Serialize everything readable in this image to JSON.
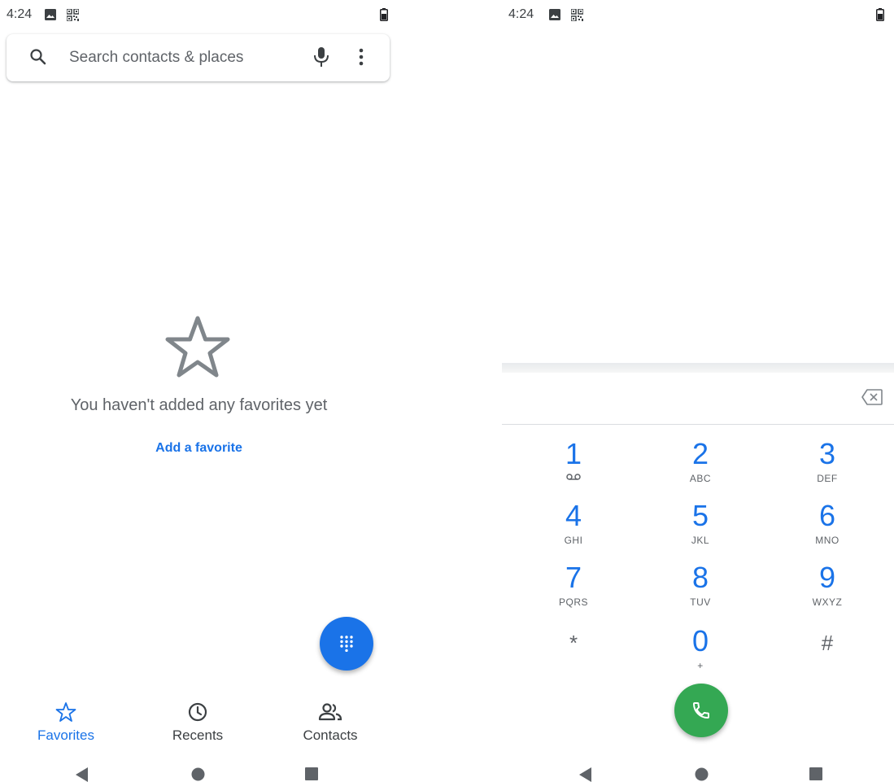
{
  "left_screen": {
    "status": {
      "time": "4:24"
    },
    "search": {
      "placeholder": "Search contacts & places"
    },
    "empty_state": {
      "message": "You haven't added any favorites yet",
      "action_label": "Add a favorite"
    },
    "bottom_nav": [
      {
        "label": "Favorites",
        "icon": "star-icon",
        "active": true
      },
      {
        "label": "Recents",
        "icon": "clock-icon",
        "active": false
      },
      {
        "label": "Contacts",
        "icon": "people-icon",
        "active": false
      }
    ]
  },
  "right_screen": {
    "status": {
      "time": "4:24"
    },
    "keypad": [
      {
        "num": "1",
        "letters": ""
      },
      {
        "num": "2",
        "letters": "ABC"
      },
      {
        "num": "3",
        "letters": "DEF"
      },
      {
        "num": "4",
        "letters": "GHI"
      },
      {
        "num": "5",
        "letters": "JKL"
      },
      {
        "num": "6",
        "letters": "MNO"
      },
      {
        "num": "7",
        "letters": "PQRS"
      },
      {
        "num": "8",
        "letters": "TUV"
      },
      {
        "num": "9",
        "letters": "WXYZ"
      },
      {
        "num": "*",
        "letters": ""
      },
      {
        "num": "0",
        "letters": "+"
      },
      {
        "num": "#",
        "letters": ""
      }
    ]
  },
  "colors": {
    "accent": "#1a73e8",
    "call_green": "#34a853",
    "text_secondary": "#5f6368"
  }
}
